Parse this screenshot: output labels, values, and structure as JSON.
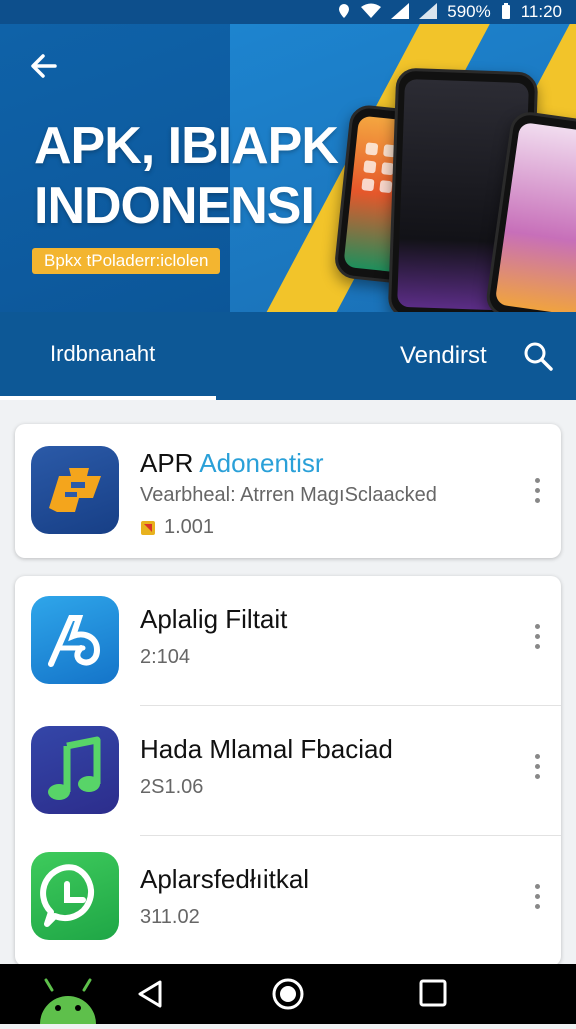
{
  "status_bar": {
    "battery": "590%",
    "time": "11:20"
  },
  "header": {
    "title_line1": "APK, IBIAPK",
    "title_line2": "INDONENSI",
    "badge": "Bpkx tPoladerr:iclolen",
    "tab_left": "Irdbnanaht",
    "tab_right": "Vendirst"
  },
  "featured": {
    "title_main": "APR",
    "title_accent": "Adonentisr",
    "subtitle": "Vearbheal: Atrren MagıSclaacked",
    "rating": "1.001",
    "accent_color": "#2aa0d8"
  },
  "apps": [
    {
      "title": "Aplalig Filtait",
      "meta": "2:104",
      "icon": "stylized-a-icon"
    },
    {
      "title": "Hada Mlamal Fbaciad",
      "meta": "2S1.06",
      "icon": "music-note-icon"
    },
    {
      "title": "Aplarsfedłıitkal",
      "meta": "311.02",
      "icon": "chat-phone-icon"
    }
  ],
  "colors": {
    "primary": "#0d5896",
    "banner_yellow": "#f2c42a",
    "badge_orange": "#f3b530"
  }
}
